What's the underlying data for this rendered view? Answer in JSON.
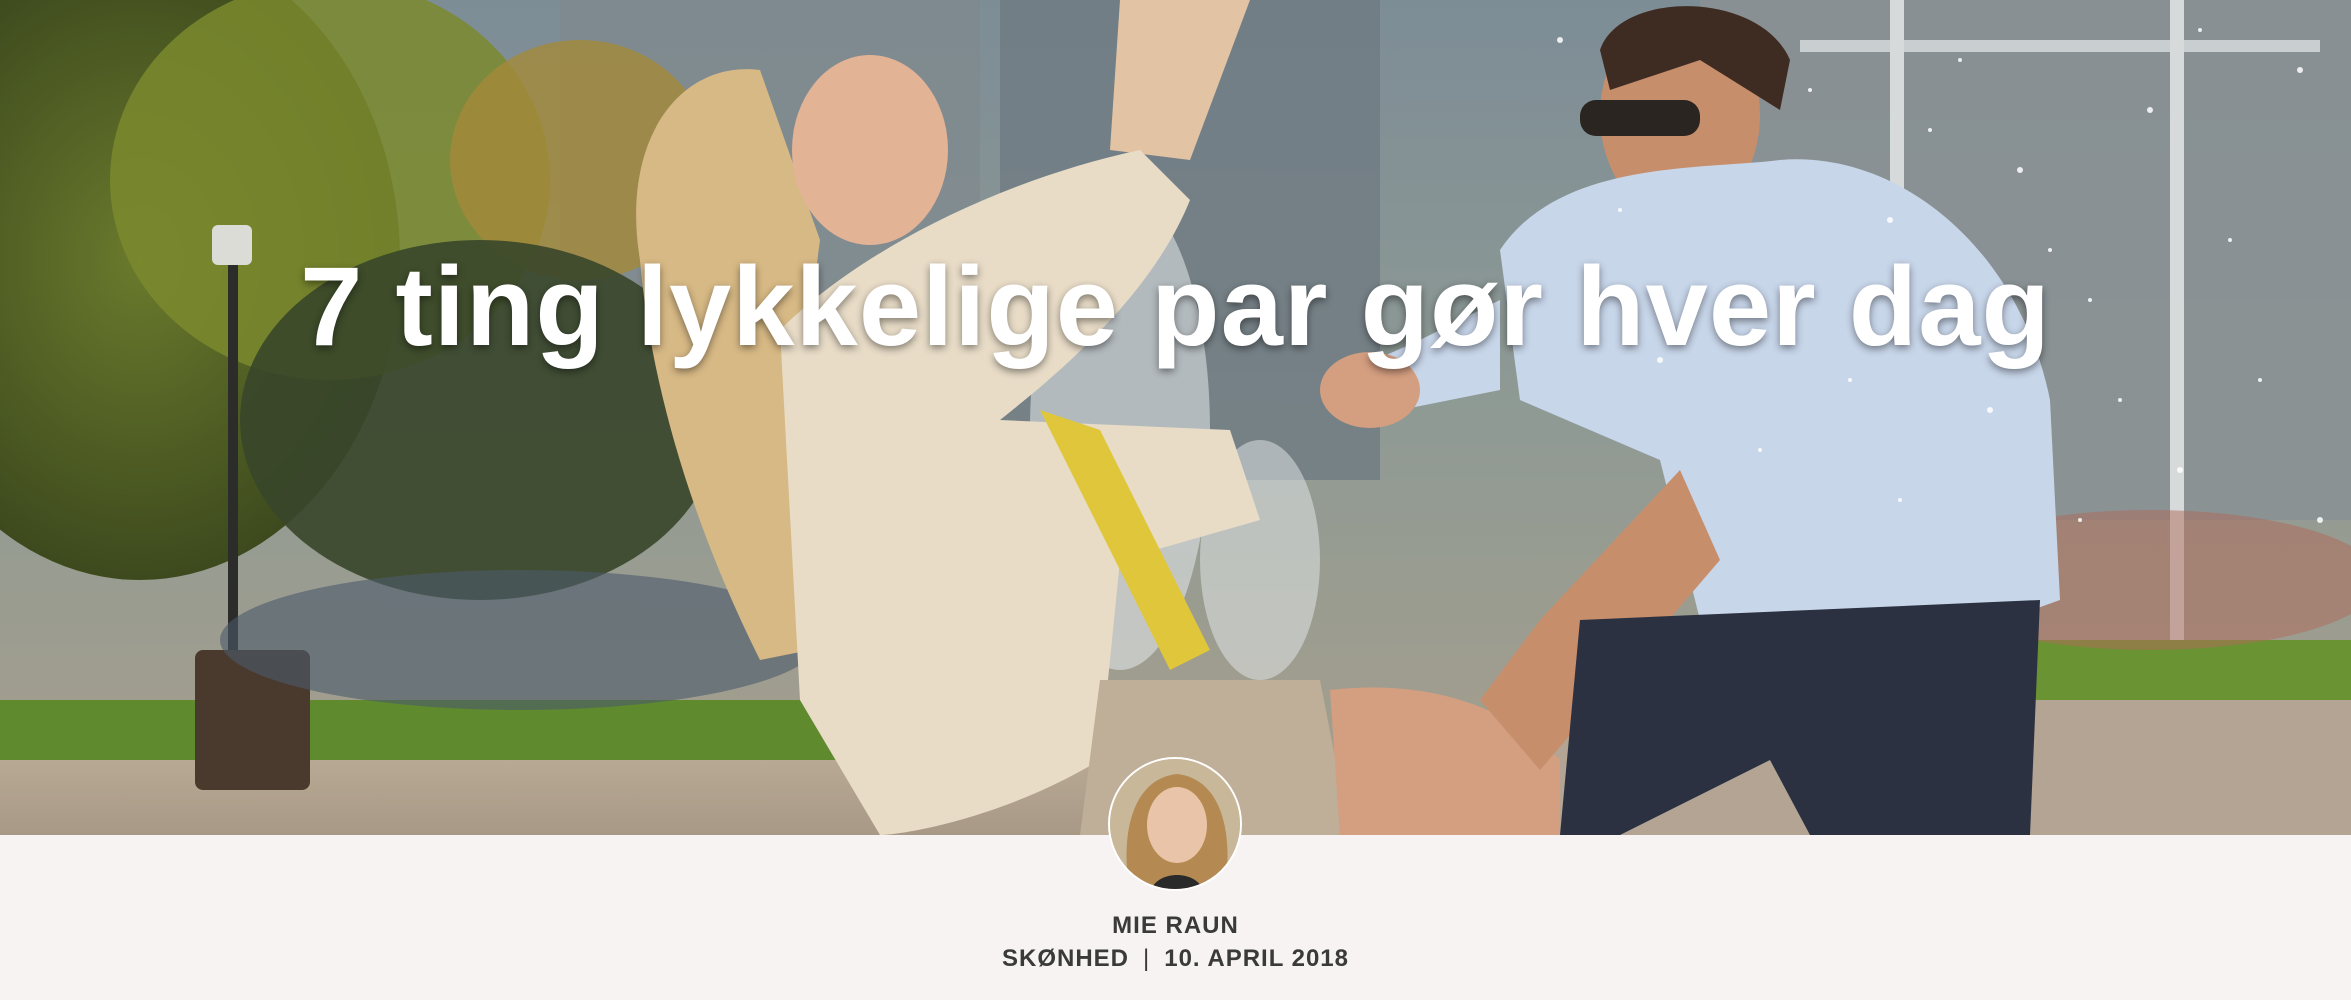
{
  "article": {
    "title": "7 ting lykkelige par gør hver dag",
    "hero_image": "couple-playing-in-fountain-photo",
    "author": {
      "name": "MIE RAUN",
      "avatar": "author-avatar-photo"
    },
    "category": "SKØNHED",
    "separator": "|",
    "date": "10. APRIL 2018"
  },
  "colors": {
    "background": "#f6f3f2",
    "title_text": "#ffffff",
    "byline_text": "#3a3a3a"
  }
}
